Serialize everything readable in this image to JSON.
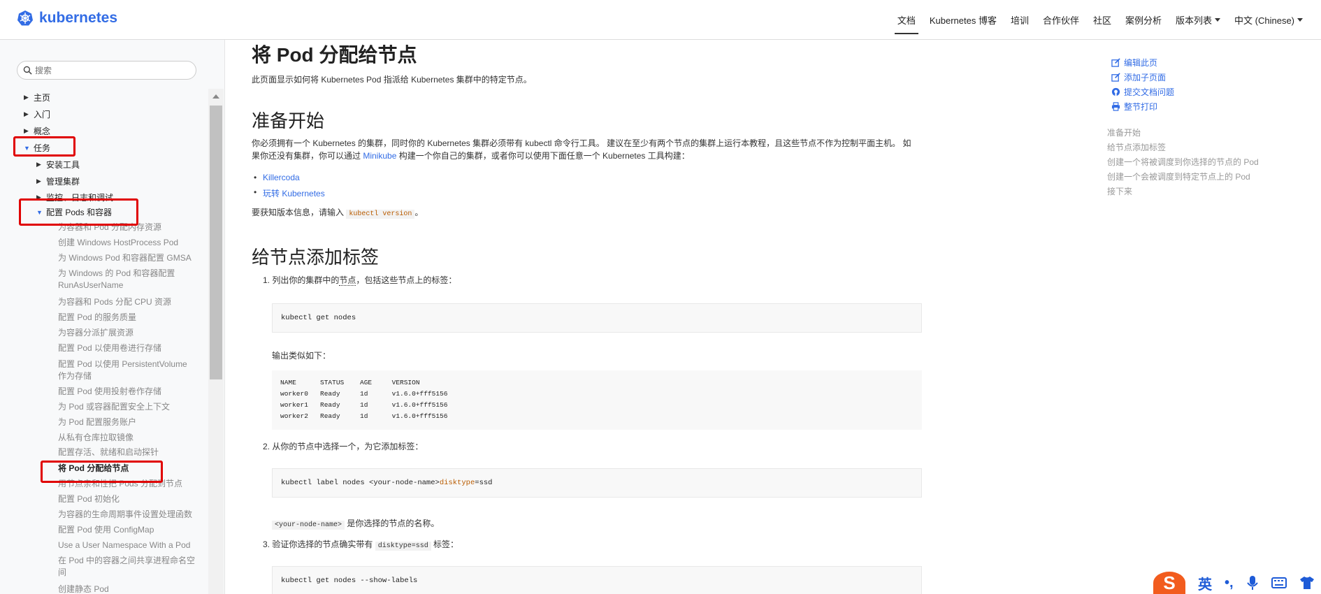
{
  "brand": {
    "name": "kubernetes"
  },
  "nav": {
    "items": [
      {
        "label": "文档",
        "active": true
      },
      {
        "label": "Kubernetes 博客",
        "active": false
      },
      {
        "label": "培训",
        "active": false
      },
      {
        "label": "合作伙伴",
        "active": false
      },
      {
        "label": "社区",
        "active": false
      },
      {
        "label": "案例分析",
        "active": false
      },
      {
        "label": "版本列表",
        "active": false,
        "dropdown": true
      },
      {
        "label": "中文 (Chinese)",
        "active": false,
        "dropdown": true
      }
    ]
  },
  "sidebar": {
    "search_placeholder": "搜索",
    "top_items": [
      "主页",
      "入门",
      "概念",
      "任务"
    ],
    "task_children": [
      "安装工具",
      "管理集群",
      "监控、日志和调试",
      "配置 Pods 和容器"
    ],
    "leaves": [
      "为容器和 Pod 分配内存资源",
      "创建 Windows HostProcess Pod",
      "为 Windows Pod 和容器配置 GMSA",
      "为 Windows 的 Pod 和容器配置 RunAsUserName",
      "为容器和 Pods 分配 CPU 资源",
      "配置 Pod 的服务质量",
      "为容器分派扩展资源",
      "配置 Pod 以使用卷进行存储",
      "配置 Pod 以使用 PersistentVolume 作为存储",
      "配置 Pod 使用投射卷作存储",
      "为 Pod 或容器配置安全上下文",
      "为 Pod 配置服务账户",
      "从私有仓库拉取镜像",
      "配置存活、就绪和启动探针",
      "将 Pod 分配给节点",
      "用节点亲和性把 Pods 分配到节点",
      "配置 Pod 初始化",
      "为容器的生命周期事件设置处理函数",
      "配置 Pod 使用 ConfigMap",
      "Use a User Namespace With a Pod",
      "在 Pod 中的容器之间共享进程命名空间",
      "创建静态 Pod"
    ]
  },
  "main": {
    "title": "将 Pod 分配给节点",
    "lead": "此页面显示如何将 Kubernetes Pod 指派给 Kubernetes 集群中的特定节点。",
    "section1": {
      "heading": "准备开始",
      "para_a": "你必须拥有一个 Kubernetes 的集群，同时你的 Kubernetes 集群必须带有 kubectl 命令行工具。 建议在至少有两个节点的集群上运行本教程，且这些节点不作为控制平面主机。 如",
      "para_b1": "果你还没有集群，你可以通过 ",
      "para_link": "Minikube",
      "para_b2": " 构建一个你自己的集群，或者你可以使用下面任意一个 Kubernetes 工具构建：",
      "bullets": [
        "Killercoda",
        "玩转 Kubernetes"
      ],
      "version_a": "要获知版本信息，请输入 ",
      "version_code": "kubectl version",
      "version_b": "。"
    },
    "section2": {
      "heading": "给节点添加标签",
      "step1_a": "1. 列出你的集群中的",
      "step1_term": "节点",
      "step1_b": "，包括这些节点上的标签：",
      "cmd1": "kubectl get nodes",
      "output_label": "输出类似如下：",
      "output": "NAME      STATUS    AGE     VERSION\nworker0   Ready     1d      v1.6.0+fff5156\nworker1   Ready     1d      v1.6.0+fff5156\nworker2   Ready     1d      v1.6.0+fff5156",
      "step2": "2. 从你的节点中选择一个，为它添加标签：",
      "cmd2_a": "kubectl label nodes <your-node-name> ",
      "cmd2_kw": "disktype",
      "cmd2_b": "=ssd",
      "note_code": "<your-node-name>",
      "note_text": " 是你选择的节点的名称。",
      "step3_a": "3. 验证你选择的节点确实带有 ",
      "step3_code": "disktype=ssd",
      "step3_b": " 标签：",
      "cmd3": "kubectl get nodes --show-labels"
    }
  },
  "toc": {
    "actions": [
      "编辑此页",
      "添加子页面",
      "提交文档问题",
      "整节打印"
    ],
    "links": [
      "准备开始",
      "给节点添加标签",
      "创建一个将被调度到你选择的节点的 Pod",
      "创建一个会被调度到特定节点上的 Pod",
      "接下来"
    ]
  },
  "ime": {
    "logo": "S",
    "lang": "英",
    "punct": "•,"
  },
  "colors": {
    "accent": "#326ce5",
    "highlight": "#e00000",
    "code_keyword": "#b85b00"
  }
}
